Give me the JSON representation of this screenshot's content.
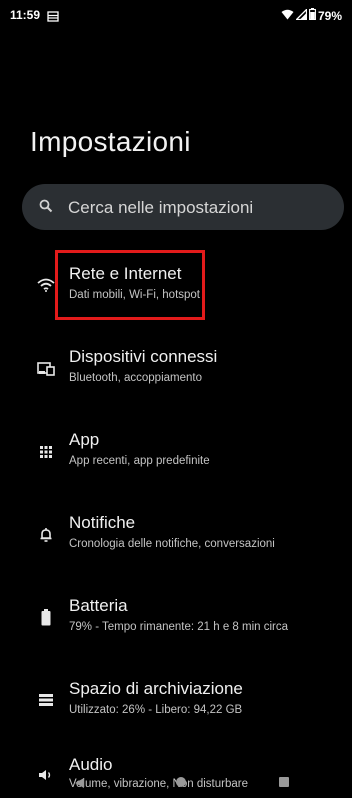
{
  "status_bar": {
    "time": "11:59",
    "battery_percent": "79%",
    "icons": [
      "storage-icon",
      "wifi-icon",
      "signal-icon",
      "battery-icon"
    ]
  },
  "page_title": "Impostazioni",
  "search": {
    "placeholder": "Cerca nelle impostazioni"
  },
  "items": [
    {
      "title": "Rete e Internet",
      "subtitle": "Dati mobili, Wi-Fi, hotspot",
      "icon": "wifi-icon"
    },
    {
      "title": "Dispositivi connessi",
      "subtitle": "Bluetooth, accoppiamento",
      "icon": "connected-devices-icon"
    },
    {
      "title": "App",
      "subtitle": "App recenti, app predefinite",
      "icon": "apps-grid-icon"
    },
    {
      "title": "Notifiche",
      "subtitle": "Cronologia delle notifiche, conversazioni",
      "icon": "bell-icon"
    },
    {
      "title": "Batteria",
      "subtitle": "79% - Tempo rimanente: 21 h e 8 min circa",
      "icon": "battery-icon"
    },
    {
      "title": "Spazio di archiviazione",
      "subtitle": "Utilizzato: 26% - Libero: 94,22 GB",
      "icon": "storage-icon"
    },
    {
      "title": "Audio",
      "subtitle": "Volume, vibrazione, Non disturbare",
      "icon": "speaker-icon"
    }
  ],
  "colors": {
    "background": "#000000",
    "search_background": "#2b2f33",
    "highlight": "#e21b1b"
  }
}
